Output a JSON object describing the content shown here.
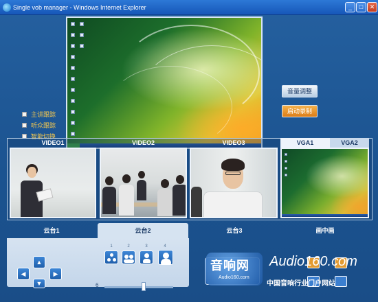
{
  "window": {
    "title": "Single vob manager - Windows Internet Explorer",
    "minimize": "_",
    "maximize": "□",
    "close": "✕"
  },
  "tracking_options": [
    {
      "label": "主讲跟踪",
      "checked": false
    },
    {
      "label": "听众跟踪",
      "checked": false
    },
    {
      "label": "智能切换",
      "checked": false
    }
  ],
  "side_buttons": {
    "volume": "音量调整",
    "record": "启动录制"
  },
  "videos": [
    {
      "label": "VIDEO1"
    },
    {
      "label": "VIDEO2"
    },
    {
      "label": "VIDEO3"
    }
  ],
  "vga_tabs": [
    "VGA1",
    "VGA2"
  ],
  "bottom_tabs": [
    "云台1",
    "云台2",
    "云台3",
    "画中画"
  ],
  "ptz": {
    "arrows": {
      "up": "▲",
      "down": "▼",
      "left": "◀",
      "right": "▶"
    },
    "preset_numbers": [
      "1",
      "2",
      "3",
      "4"
    ],
    "zoom_value": "6"
  },
  "watermark": {
    "logo_text": "音响网",
    "logo_sub": "Audio160.com",
    "brand": "Audio160.com",
    "tagline": "中国音响行业门户网站"
  },
  "colors": {
    "accent_blue": "#1d4f86",
    "record_orange": "#e08020",
    "checkbox_label": "#f5c84e"
  }
}
